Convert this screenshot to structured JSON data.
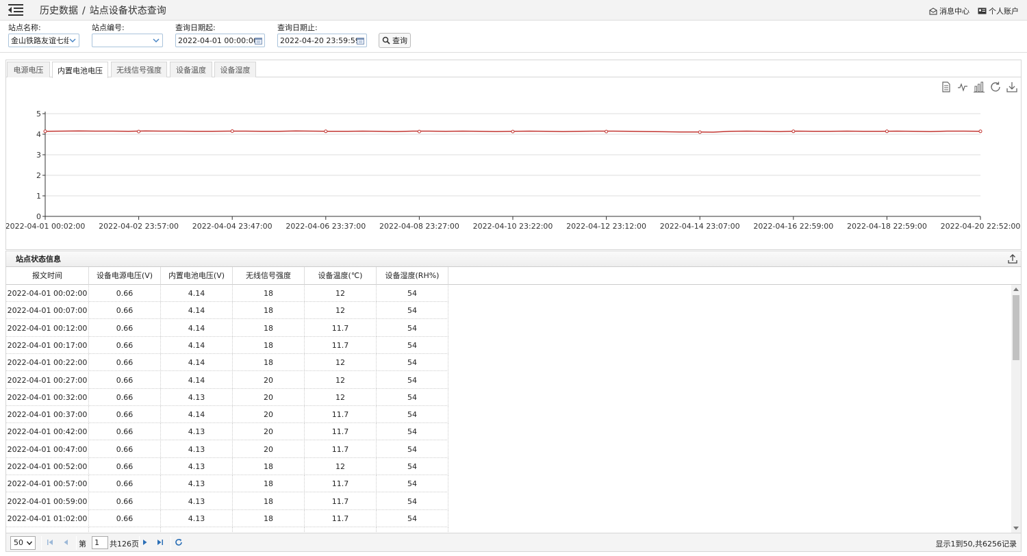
{
  "header": {
    "breadcrumb_section": "历史数据",
    "breadcrumb_sep": "/",
    "breadcrumb_page": "站点设备状态查询",
    "messages_label": "消息中心",
    "account_label": "个人账户"
  },
  "filters": {
    "station_name_label": "站点名称:",
    "station_name_value": "金山铁路友谊七组",
    "station_code_label": "站点编号:",
    "station_code_value": "",
    "date_start_label": "查询日期起:",
    "date_start_value": "2022-04-01 00:00:00",
    "date_end_label": "查询日期止:",
    "date_end_value": "2022-04-20 23:59:59",
    "query_button": "查询"
  },
  "tabs": [
    {
      "label": "电源电压",
      "active": false
    },
    {
      "label": "内置电池电压",
      "active": true
    },
    {
      "label": "无线信号强度",
      "active": false
    },
    {
      "label": "设备温度",
      "active": false
    },
    {
      "label": "设备湿度",
      "active": false
    }
  ],
  "chart_data": {
    "type": "line",
    "ylim": [
      0,
      5
    ],
    "yticks": [
      0,
      1,
      2,
      3,
      4,
      5
    ],
    "xticks": [
      "2022-04-01 00:02:00",
      "2022-04-02 23:57:00",
      "2022-04-04 23:47:00",
      "2022-04-06 23:37:00",
      "2022-04-08 23:27:00",
      "2022-04-10 23:22:00",
      "2022-04-12 23:12:00",
      "2022-04-14 23:07:00",
      "2022-04-16 22:59:00",
      "2022-04-18 22:59:00",
      "2022-04-20 22:52:00"
    ],
    "series": [
      {
        "color": "#c23531",
        "values": [
          4.14,
          4.15,
          4.16,
          4.15,
          4.15,
          4.14,
          4.16,
          4.15,
          4.15,
          4.14,
          4.14,
          4.15,
          4.15,
          4.14,
          4.14,
          4.16,
          4.15,
          4.14,
          4.14,
          4.15,
          4.14,
          4.13,
          4.15,
          4.15,
          4.14,
          4.15,
          4.14,
          4.13,
          4.14,
          4.15,
          4.14,
          4.13,
          4.14,
          4.15,
          4.15,
          4.14,
          4.13,
          4.12,
          4.11,
          4.11,
          4.1,
          4.14,
          4.15,
          4.14,
          4.13,
          4.15,
          4.14,
          4.14,
          4.15,
          4.14,
          4.14,
          4.15,
          4.14,
          4.13,
          4.15,
          4.15,
          4.14
        ]
      }
    ],
    "markers": [
      4.14,
      4.13,
      4.15,
      4.14,
      4.13,
      4.13,
      4.13,
      4.1,
      4.14,
      4.14,
      4.14
    ]
  },
  "chart_tools": [
    "data-view-icon",
    "line-chart-icon",
    "bar-chart-icon",
    "restore-icon",
    "save-image-icon"
  ],
  "grid": {
    "title": "站点状态信息",
    "columns": [
      "报文时间",
      "设备电源电压(V)",
      "内置电池电压(V)",
      "无线信号强度",
      "设备温度(℃)",
      "设备湿度(RH%)"
    ],
    "rows": [
      [
        "2022-04-01 00:02:00",
        "0.66",
        "4.14",
        "18",
        "12",
        "54"
      ],
      [
        "2022-04-01 00:07:00",
        "0.66",
        "4.14",
        "18",
        "12",
        "54"
      ],
      [
        "2022-04-01 00:12:00",
        "0.66",
        "4.14",
        "18",
        "11.7",
        "54"
      ],
      [
        "2022-04-01 00:17:00",
        "0.66",
        "4.14",
        "18",
        "11.7",
        "54"
      ],
      [
        "2022-04-01 00:22:00",
        "0.66",
        "4.14",
        "18",
        "12",
        "54"
      ],
      [
        "2022-04-01 00:27:00",
        "0.66",
        "4.14",
        "20",
        "12",
        "54"
      ],
      [
        "2022-04-01 00:32:00",
        "0.66",
        "4.13",
        "20",
        "12",
        "54"
      ],
      [
        "2022-04-01 00:37:00",
        "0.66",
        "4.14",
        "20",
        "11.7",
        "54"
      ],
      [
        "2022-04-01 00:42:00",
        "0.66",
        "4.13",
        "20",
        "11.7",
        "54"
      ],
      [
        "2022-04-01 00:47:00",
        "0.66",
        "4.13",
        "20",
        "11.7",
        "54"
      ],
      [
        "2022-04-01 00:52:00",
        "0.66",
        "4.13",
        "18",
        "12",
        "54"
      ],
      [
        "2022-04-01 00:57:00",
        "0.66",
        "4.13",
        "18",
        "11.7",
        "54"
      ],
      [
        "2022-04-01 00:59:00",
        "0.66",
        "4.13",
        "18",
        "11.7",
        "54"
      ],
      [
        "2022-04-01 01:02:00",
        "0.66",
        "4.13",
        "18",
        "11.7",
        "54"
      ],
      [
        "",
        "",
        "",
        "",
        "",
        ""
      ]
    ]
  },
  "pager": {
    "page_size": "50",
    "page_prefix": "第",
    "page_value": "1",
    "page_total": "共126页",
    "info": "显示1到50,共6256记录"
  }
}
